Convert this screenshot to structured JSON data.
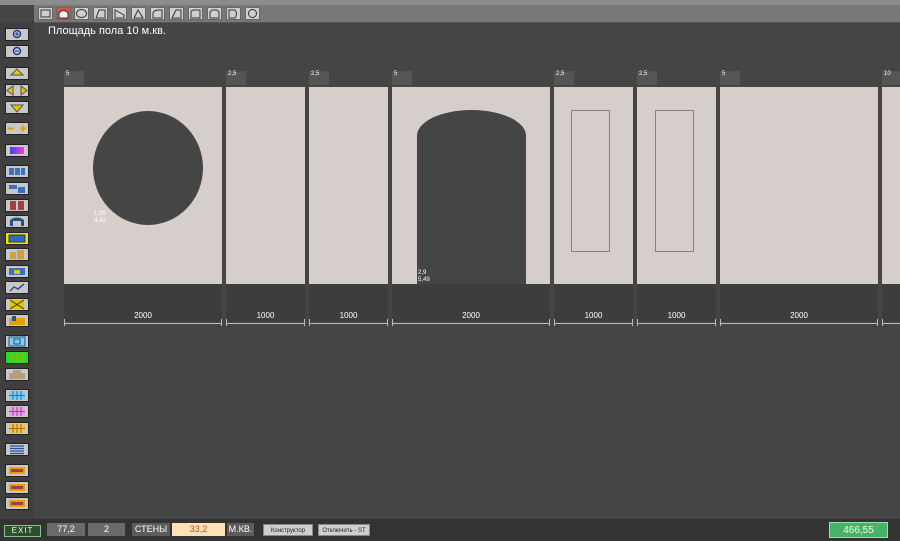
{
  "header": {
    "area_title": "Площадь пола 10 м.кв."
  },
  "panels": [
    {
      "tag": "5",
      "width_label": "2000"
    },
    {
      "tag": "2,5",
      "width_label": "1000"
    },
    {
      "tag": "2,5",
      "width_label": "1000"
    },
    {
      "tag": "5",
      "width_label": "2000"
    },
    {
      "tag": "2,5",
      "width_label": "1000"
    },
    {
      "tag": "2,5",
      "width_label": "1000"
    },
    {
      "tag": "5",
      "width_label": "2000"
    },
    {
      "tag": "10",
      "width_label": ""
    }
  ],
  "openings": {
    "circle": {
      "line1": "1,09",
      "line2": "4,42"
    },
    "arch": {
      "line1": "2,9",
      "line2": "5,49"
    }
  },
  "statusbar": {
    "exit_label": "EXIT",
    "value1": "77,2",
    "value2": "2",
    "walls_label": "СТЕНЫ",
    "walls_value": "33,2",
    "unit": "М.КВ.",
    "constructor_label": "Конструктор",
    "disable_label": "Отключить - ST",
    "total": "466,55"
  },
  "colors": {
    "panel": "#d6cecb",
    "background": "#454545",
    "active_shape": "#d8553a",
    "highlight_yellow": "#f2e600",
    "highlight_green": "#2bd82b",
    "total_green": "#49b168"
  }
}
